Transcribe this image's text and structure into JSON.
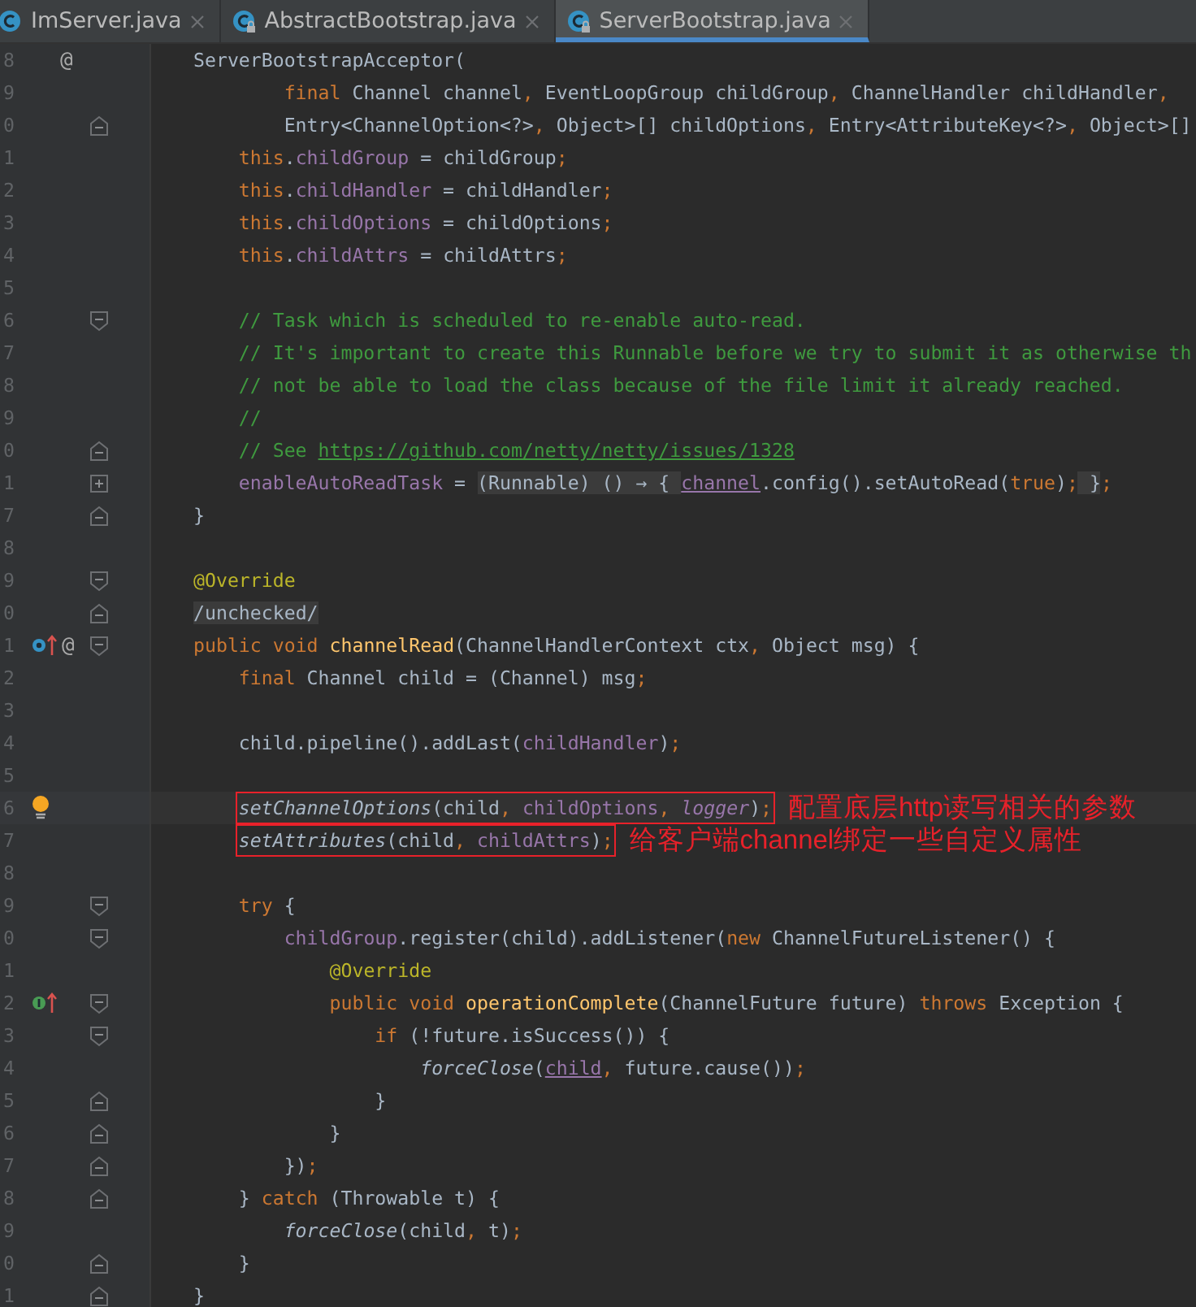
{
  "tabs": [
    {
      "label": "ImServer.java",
      "selected": false,
      "locked": false
    },
    {
      "label": "AbstractBootstrap.java",
      "selected": false,
      "locked": true
    },
    {
      "label": "ServerBootstrap.java",
      "selected": true,
      "locked": true
    }
  ],
  "lines": [
    {
      "number": "8",
      "gutter": [
        {
          "kind": "at",
          "text": "@"
        }
      ],
      "segments": [
        {
          "kind": "plain",
          "text": "ServerBootstrapAcceptor("
        }
      ],
      "children": [
        {
          "number": "9",
          "kind": "continuation",
          "segments": [
            {
              "kind": "kw",
              "text": "final "
            },
            {
              "kind": "plain",
              "text": "Channel channel"
            },
            {
              "kind": "kw",
              "text": ", "
            },
            {
              "kind": "plain",
              "text": "EventLoopGroup childGroup"
            },
            {
              "kind": "kw",
              "text": ", "
            },
            {
              "kind": "plain",
              "text": "ChannelHandler childHandler"
            },
            {
              "kind": "kw",
              "text": ","
            }
          ]
        },
        {
          "number": "0",
          "kind": "continuation",
          "fold": {
            "kind": "end"
          },
          "segments": [
            {
              "kind": "plain",
              "text": "Entry<ChannelOption<?>"
            },
            {
              "kind": "kw",
              "text": ", "
            },
            {
              "kind": "plain",
              "text": "Object>[] childOptions"
            },
            {
              "kind": "kw",
              "text": ", "
            },
            {
              "kind": "plain",
              "text": "Entry<AttributeKey<?>"
            },
            {
              "kind": "kw",
              "text": ", "
            },
            {
              "kind": "plain",
              "text": "Object>[]"
            }
          ]
        },
        {
          "number": "1",
          "segments": [
            {
              "kind": "kw",
              "text": "this"
            },
            {
              "kind": "plain",
              "text": "."
            },
            {
              "kind": "field",
              "text": "childGroup"
            },
            {
              "kind": "plain",
              "text": " = childGroup"
            },
            {
              "kind": "kw",
              "text": ";"
            }
          ]
        },
        {
          "number": "2",
          "segments": [
            {
              "kind": "kw",
              "text": "this"
            },
            {
              "kind": "plain",
              "text": "."
            },
            {
              "kind": "field",
              "text": "childHandler"
            },
            {
              "kind": "plain",
              "text": " = childHandler"
            },
            {
              "kind": "kw",
              "text": ";"
            }
          ]
        },
        {
          "number": "3",
          "segments": [
            {
              "kind": "kw",
              "text": "this"
            },
            {
              "kind": "plain",
              "text": "."
            },
            {
              "kind": "field",
              "text": "childOptions"
            },
            {
              "kind": "plain",
              "text": " = childOptions"
            },
            {
              "kind": "kw",
              "text": ";"
            }
          ]
        },
        {
          "number": "4",
          "segments": [
            {
              "kind": "kw",
              "text": "this"
            },
            {
              "kind": "plain",
              "text": "."
            },
            {
              "kind": "field",
              "text": "childAttrs"
            },
            {
              "kind": "plain",
              "text": " = childAttrs"
            },
            {
              "kind": "kw",
              "text": ";"
            }
          ]
        },
        {
          "number": "5"
        },
        {
          "number": "6",
          "fold": {
            "kind": "start"
          },
          "segments": [
            {
              "kind": "comment",
              "text": "// Task which is scheduled to re-enable auto-read."
            }
          ]
        },
        {
          "number": "7",
          "segments": [
            {
              "kind": "comment",
              "text": "// It's important to create this Runnable before we try to submit it as otherwise th"
            }
          ]
        },
        {
          "number": "8",
          "segments": [
            {
              "kind": "comment",
              "text": "// not be able to load the class because of the file limit it already reached."
            }
          ]
        },
        {
          "number": "9",
          "segments": [
            {
              "kind": "comment",
              "text": "//"
            }
          ]
        },
        {
          "number": "0",
          "fold": {
            "kind": "end"
          },
          "segments": [
            {
              "kind": "comment",
              "text": "// See "
            },
            {
              "kind": "link",
              "text": "https://github.com/netty/netty/issues/1328"
            }
          ]
        },
        {
          "number": "1",
          "fold": {
            "kind": "collapsed"
          },
          "segments": [
            {
              "kind": "field",
              "text": "enableAutoReadTask"
            },
            {
              "kind": "plain",
              "text": " = "
            },
            {
              "kind": "folded",
              "text": "(Runnable) () → { "
            },
            {
              "kind": "ul",
              "text": "channel"
            },
            {
              "kind": "plain",
              "text": ".config().setAutoRead("
            },
            {
              "kind": "kw",
              "text": "true"
            },
            {
              "kind": "plain",
              "text": ")"
            },
            {
              "kind": "kw",
              "text": ";"
            },
            {
              "kind": "folded",
              "text": " }"
            },
            {
              "kind": "kw",
              "text": ";"
            }
          ]
        }
      ]
    },
    {
      "number": "7",
      "fold": {
        "kind": "end"
      },
      "segments": [
        {
          "kind": "plain",
          "text": "}"
        }
      ]
    },
    {
      "number": "8"
    },
    {
      "number": "9",
      "fold": {
        "kind": "start"
      },
      "segments": [
        {
          "kind": "annot",
          "text": "@Override"
        }
      ]
    },
    {
      "number": "0",
      "fold": {
        "kind": "end"
      },
      "segments": [
        {
          "kind": "folded",
          "text": "/unchecked/"
        }
      ]
    },
    {
      "number": "1",
      "gutter": [
        {
          "kind": "override"
        },
        {
          "kind": "at",
          "text": "@"
        }
      ],
      "fold": {
        "kind": "start"
      },
      "segments": [
        {
          "kind": "kw",
          "text": "public void "
        },
        {
          "kind": "decl",
          "text": "channelRead"
        },
        {
          "kind": "plain",
          "text": "(ChannelHandlerContext ctx"
        },
        {
          "kind": "kw",
          "text": ", "
        },
        {
          "kind": "plain",
          "text": "Object msg) {"
        }
      ],
      "children": [
        {
          "number": "2",
          "segments": [
            {
              "kind": "kw",
              "text": "final "
            },
            {
              "kind": "plain",
              "text": "Channel child = (Channel) msg"
            },
            {
              "kind": "kw",
              "text": ";"
            }
          ]
        },
        {
          "number": "3"
        },
        {
          "number": "4",
          "segments": [
            {
              "kind": "plain",
              "text": "child.pipeline().addLast("
            },
            {
              "kind": "field",
              "text": "childHandler"
            },
            {
              "kind": "plain",
              "text": ")"
            },
            {
              "kind": "kw",
              "text": ";"
            }
          ]
        },
        {
          "number": "5"
        },
        {
          "number": "6",
          "gutter": [
            {
              "kind": "bulb"
            }
          ],
          "current": true,
          "marked": true,
          "note": "配置底层http读写相关的参数",
          "segments": [
            {
              "kind": "italic",
              "text": "setChannelOptions"
            },
            {
              "kind": "plain",
              "text": "(child"
            },
            {
              "kind": "kw",
              "text": ", "
            },
            {
              "kind": "field",
              "text": "childOptions"
            },
            {
              "kind": "kw",
              "text": ", "
            },
            {
              "kind": "param",
              "text": "logger"
            },
            {
              "kind": "plain",
              "text": ")"
            },
            {
              "kind": "kw",
              "text": ";"
            }
          ]
        },
        {
          "number": "7",
          "marked": true,
          "note": "给客户端channel绑定一些自定义属性",
          "segments": [
            {
              "kind": "italic",
              "text": "setAttributes"
            },
            {
              "kind": "plain",
              "text": "(child"
            },
            {
              "kind": "kw",
              "text": ", "
            },
            {
              "kind": "field",
              "text": "childAttrs"
            },
            {
              "kind": "plain",
              "text": ")"
            },
            {
              "kind": "kw",
              "text": ";"
            }
          ]
        },
        {
          "number": "8"
        },
        {
          "number": "9",
          "fold": {
            "kind": "start"
          },
          "segments": [
            {
              "kind": "kw",
              "text": "try "
            },
            {
              "kind": "plain",
              "text": "{"
            }
          ],
          "children": [
            {
              "number": "0",
              "fold": {
                "kind": "start"
              },
              "segments": [
                {
                  "kind": "field",
                  "text": "childGroup"
                },
                {
                  "kind": "plain",
                  "text": ".register(child).addListener("
                },
                {
                  "kind": "kw",
                  "text": "new "
                },
                {
                  "kind": "plain",
                  "text": "ChannelFutureListener() {"
                }
              ],
              "children": [
                {
                  "number": "1",
                  "segments": [
                    {
                      "kind": "annot",
                      "text": "@Override"
                    }
                  ]
                },
                {
                  "number": "2",
                  "gutter": [
                    {
                      "kind": "implements"
                    }
                  ],
                  "fold": {
                    "kind": "start"
                  },
                  "segments": [
                    {
                      "kind": "kw",
                      "text": "public void "
                    },
                    {
                      "kind": "decl",
                      "text": "operationComplete"
                    },
                    {
                      "kind": "plain",
                      "text": "(ChannelFuture future) "
                    },
                    {
                      "kind": "kw",
                      "text": "throws "
                    },
                    {
                      "kind": "plain",
                      "text": "Exception {"
                    }
                  ],
                  "children": [
                    {
                      "number": "3",
                      "fold": {
                        "kind": "start"
                      },
                      "segments": [
                        {
                          "kind": "kw",
                          "text": "if "
                        },
                        {
                          "kind": "plain",
                          "text": "(!future.isSuccess()) {"
                        }
                      ],
                      "children": [
                        {
                          "number": "4",
                          "segments": [
                            {
                              "kind": "italic",
                              "text": "forceClose"
                            },
                            {
                              "kind": "plain",
                              "text": "("
                            },
                            {
                              "kind": "ul",
                              "text": "child"
                            },
                            {
                              "kind": "kw",
                              "text": ", "
                            },
                            {
                              "kind": "plain",
                              "text": "future.cause())"
                            },
                            {
                              "kind": "kw",
                              "text": ";"
                            }
                          ]
                        }
                      ]
                    },
                    {
                      "number": "5",
                      "fold": {
                        "kind": "end"
                      },
                      "segments": [
                        {
                          "kind": "plain",
                          "text": "}"
                        }
                      ]
                    }
                  ]
                },
                {
                  "number": "6",
                  "fold": {
                    "kind": "end"
                  },
                  "segments": [
                    {
                      "kind": "plain",
                      "text": "}"
                    }
                  ]
                }
              ]
            },
            {
              "number": "7",
              "fold": {
                "kind": "end"
              },
              "segments": [
                {
                  "kind": "plain",
                  "text": "})"
                },
                {
                  "kind": "kw",
                  "text": ";"
                }
              ]
            }
          ]
        },
        {
          "number": "8",
          "fold": {
            "kind": "end"
          },
          "segments": [
            {
              "kind": "plain",
              "text": "} "
            },
            {
              "kind": "kw",
              "text": "catch "
            },
            {
              "kind": "plain",
              "text": "(Throwable t) {"
            }
          ],
          "children": [
            {
              "number": "9",
              "segments": [
                {
                  "kind": "italic",
                  "text": "forceClose"
                },
                {
                  "kind": "plain",
                  "text": "(child"
                },
                {
                  "kind": "kw",
                  "text": ", "
                },
                {
                  "kind": "plain",
                  "text": "t)"
                },
                {
                  "kind": "kw",
                  "text": ";"
                }
              ]
            }
          ]
        },
        {
          "number": "0",
          "fold": {
            "kind": "end"
          },
          "segments": [
            {
              "kind": "plain",
              "text": "}"
            }
          ]
        }
      ]
    },
    {
      "number": "1",
      "fold": {
        "kind": "end"
      },
      "segments": [
        {
          "kind": "plain",
          "text": "}"
        }
      ]
    }
  ]
}
